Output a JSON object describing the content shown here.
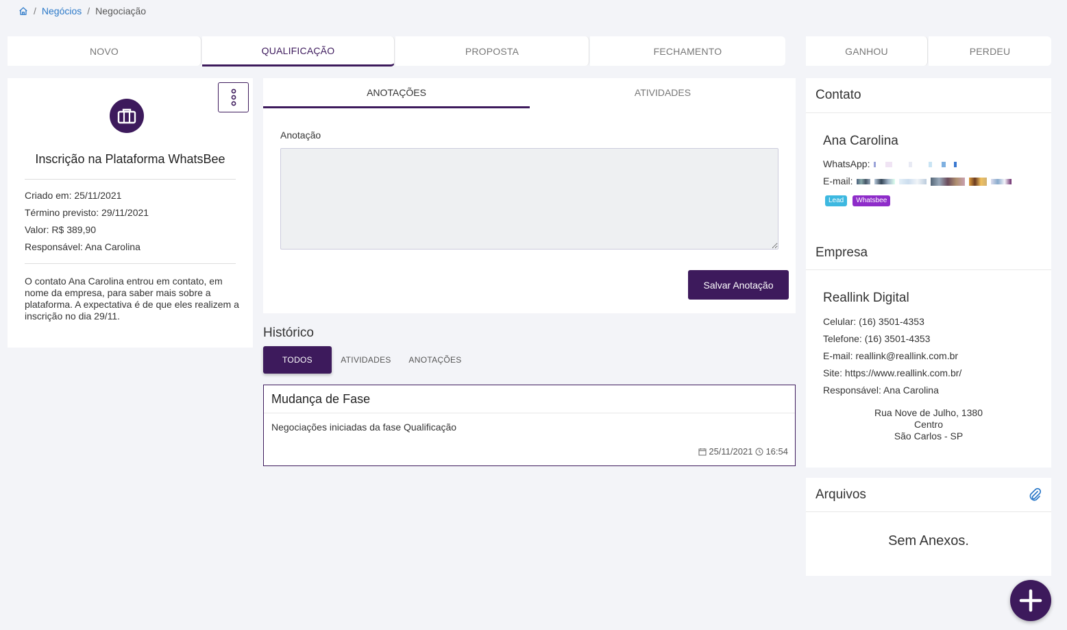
{
  "breadcrumb": {
    "home_icon": "home-icon",
    "items": [
      "Negócios",
      "Negociação"
    ],
    "separator": "/"
  },
  "stages": {
    "items": [
      "NOVO",
      "QUALIFICAÇÃO",
      "PROPOSTA",
      "FECHAMENTO"
    ],
    "active": "QUALIFICAÇÃO",
    "outcomes": [
      "GANHOU",
      "PERDEU"
    ]
  },
  "deal": {
    "icon": "briefcase-icon",
    "title": "Inscrição na Plataforma WhatsBee",
    "created": "Criado em: 25/11/2021",
    "expected_end": "Término previsto: 29/11/2021",
    "value": "Valor: R$ 389,90",
    "owner": "Responsável: Ana Carolina",
    "description": "O contato Ana Carolina entrou em contato, em nome da empresa, para saber mais sobre a plataforma. A expectativa é de que eles realizem a inscrição no dia 29/11."
  },
  "notes": {
    "tabs": [
      "ANOTAÇÕES",
      "ATIVIDADES"
    ],
    "field_label": "Anotação",
    "field_value": "",
    "save_label": "Salvar Anotação"
  },
  "history": {
    "title": "Histórico",
    "tabs": [
      "TODOS",
      "ATIVIDADES",
      "ANOTAÇÕES"
    ],
    "entry": {
      "title": "Mudança de Fase",
      "body": "Negociações iniciadas da fase Qualificação",
      "date": "25/11/2021",
      "time": "16:54"
    }
  },
  "contact": {
    "section_title": "Contato",
    "name": "Ana Carolina",
    "whatsapp_label": "WhatsApp:",
    "email_label": "E-mail:",
    "tags": [
      {
        "label": "Lead",
        "color": "#3db8e0"
      },
      {
        "label": "Whatsbee",
        "color": "#8e2cc9"
      }
    ]
  },
  "company": {
    "section_title": "Empresa",
    "name": "Reallink Digital",
    "mobile": "Celular: (16) 3501-4353",
    "phone": "Telefone: (16) 3501-4353",
    "email": "E-mail: reallink@reallink.com.br",
    "site": "Site: https://www.reallink.com.br/",
    "owner": "Responsável: Ana Carolina",
    "address_line1": "Rua Nove de Julho, 1380",
    "address_line2": "Centro",
    "address_line3": "São Carlos - SP"
  },
  "files": {
    "section_title": "Arquivos",
    "empty_text": "Sem Anexos.",
    "attach_icon": "paperclip-icon"
  },
  "fab": {
    "icon": "plus-icon"
  },
  "colors": {
    "primary": "#3d1a5c",
    "link": "#2a78c8",
    "background": "#f3f4f8"
  }
}
